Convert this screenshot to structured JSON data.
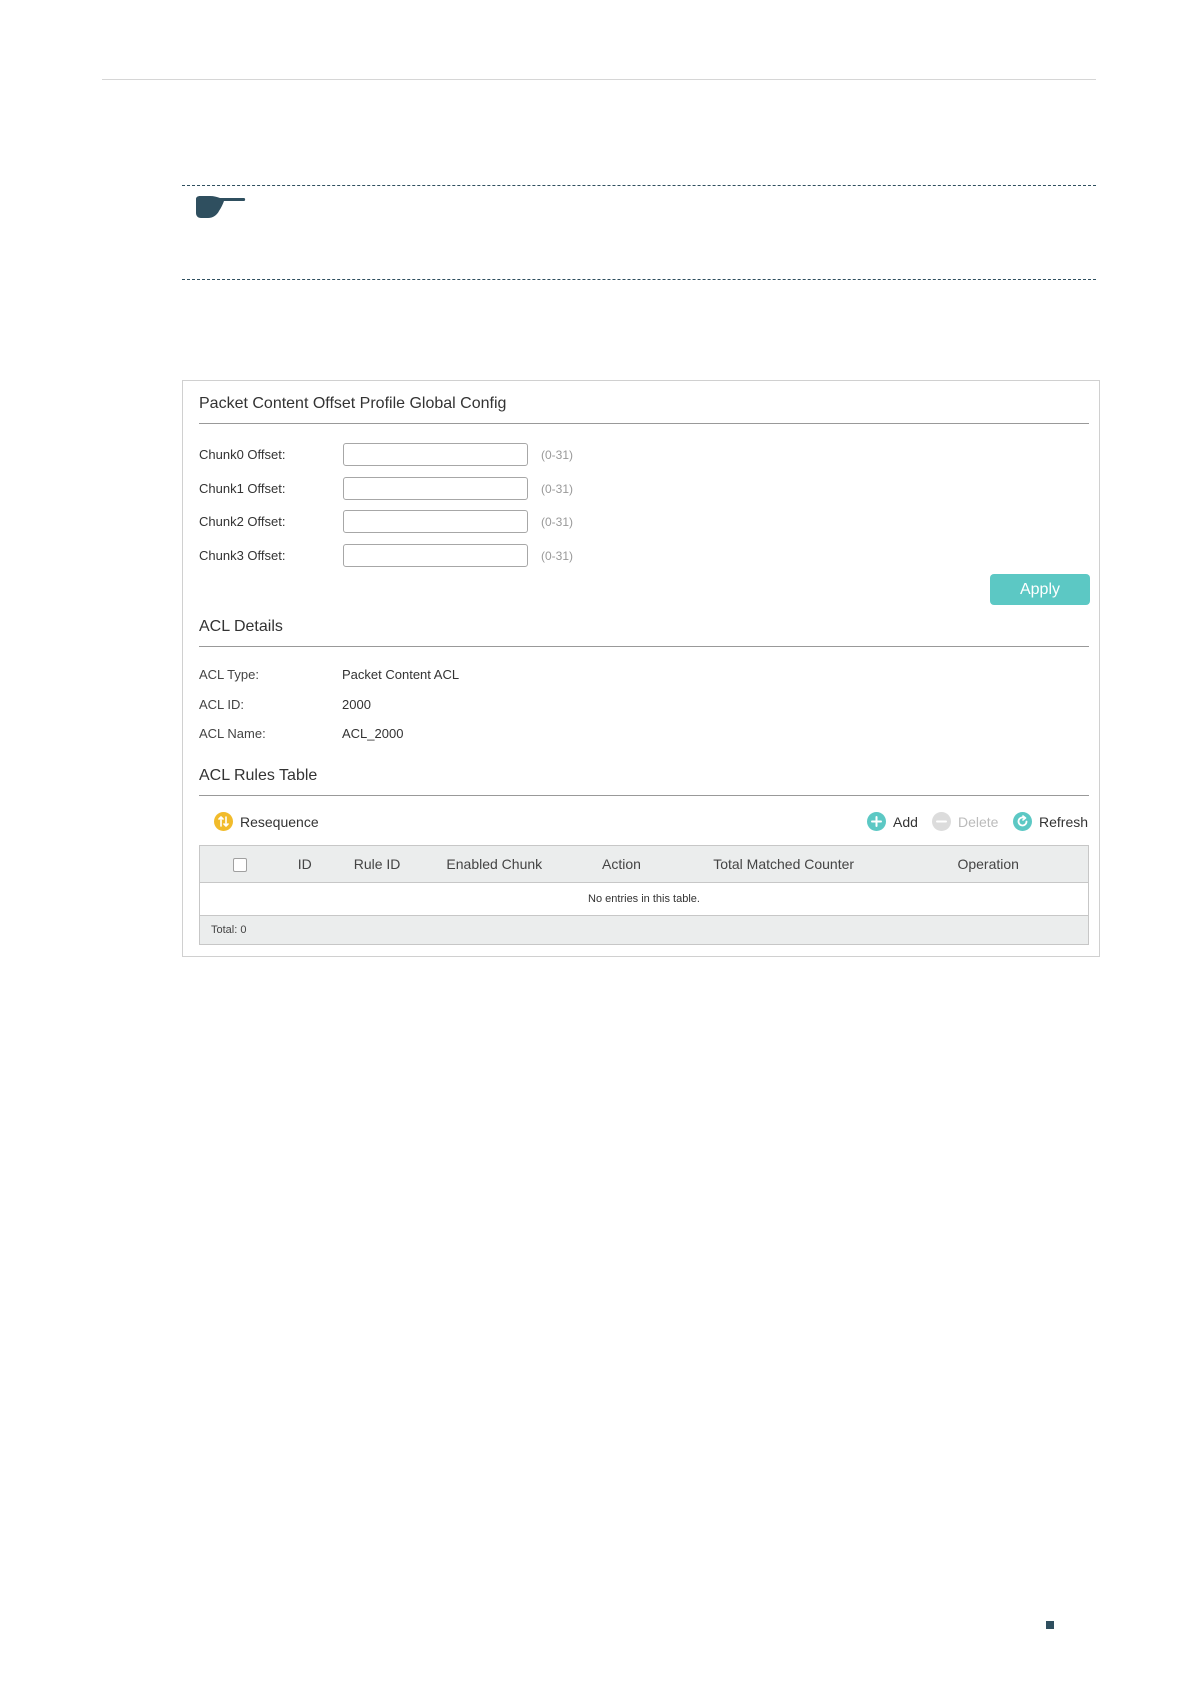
{
  "panel": {
    "global_config": {
      "title": "Packet Content Offset Profile Global Config",
      "fields": [
        {
          "label": "Chunk0 Offset:",
          "value": "",
          "hint": "(0-31)"
        },
        {
          "label": "Chunk1 Offset:",
          "value": "",
          "hint": "(0-31)"
        },
        {
          "label": "Chunk2 Offset:",
          "value": "",
          "hint": "(0-31)"
        },
        {
          "label": "Chunk3 Offset:",
          "value": "",
          "hint": "(0-31)"
        }
      ],
      "apply_label": "Apply"
    },
    "acl_details": {
      "title": "ACL Details",
      "rows": [
        {
          "label": "ACL Type:",
          "value": "Packet Content ACL"
        },
        {
          "label": "ACL ID:",
          "value": "2000"
        },
        {
          "label": "ACL Name:",
          "value": "ACL_2000"
        }
      ]
    },
    "rules_table": {
      "title": "ACL Rules Table",
      "toolbar": {
        "resequence": "Resequence",
        "add": "Add",
        "delete": "Delete",
        "refresh": "Refresh"
      },
      "columns": [
        "ID",
        "Rule ID",
        "Enabled Chunk",
        "Action",
        "Total Matched Counter",
        "Operation"
      ],
      "empty_text": "No entries in this table.",
      "total": "Total: 0"
    }
  },
  "colors": {
    "accent": "#5cc8c4",
    "resequence_icon": "#f1bb2b",
    "note_icon": "#2f4f5f",
    "disabled": "#bbbbbb"
  },
  "icons": [
    "pointing-hand-icon",
    "resequence-icon",
    "add-icon",
    "delete-icon",
    "refresh-icon"
  ]
}
